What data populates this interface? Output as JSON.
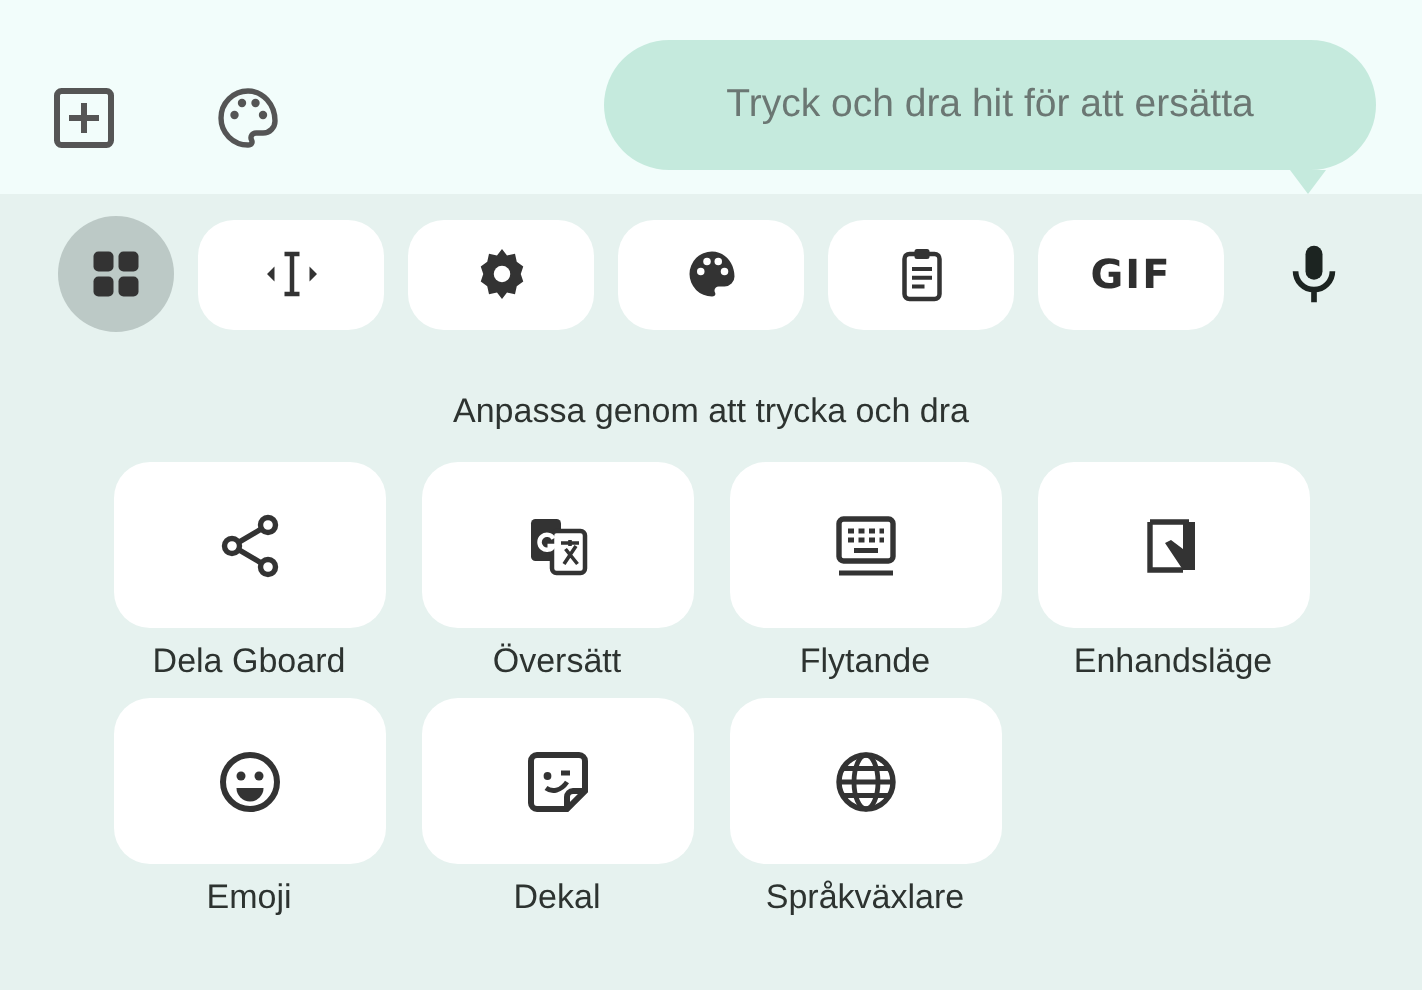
{
  "top_bar": {
    "icons": [
      {
        "kind": "add"
      },
      {
        "kind": "palette"
      }
    ]
  },
  "tooltip": {
    "text": "Tryck och dra hit för att ersätta"
  },
  "toolbar": [
    {
      "kind": "grid",
      "selected": true
    },
    {
      "kind": "cursor",
      "selected": false
    },
    {
      "kind": "settings",
      "selected": false
    },
    {
      "kind": "theme",
      "selected": false
    },
    {
      "kind": "clipboard",
      "selected": false
    },
    {
      "kind": "gif",
      "label": "GIF",
      "selected": false
    },
    {
      "kind": "mic",
      "selected": false
    }
  ],
  "heading": "Anpassa genom att trycka och dra",
  "tiles": [
    {
      "kind": "share",
      "label": "Dela Gboard"
    },
    {
      "kind": "translate",
      "label": "Översätt"
    },
    {
      "kind": "floating",
      "label": "Flytande"
    },
    {
      "kind": "onehand",
      "label": "Enhandsläge"
    },
    {
      "kind": "emoji",
      "label": "Emoji"
    },
    {
      "kind": "sticker",
      "label": "Dekal"
    },
    {
      "kind": "globe",
      "label": "Språkväxlare"
    }
  ]
}
